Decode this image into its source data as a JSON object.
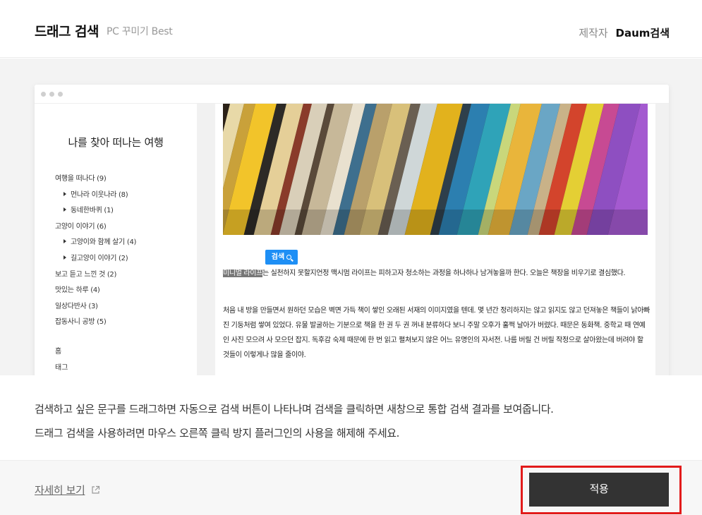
{
  "header": {
    "title": "드래그 검색",
    "subtitle": "PC 꾸미기 Best",
    "maker_label": "제작자",
    "maker_name": "Daum검색"
  },
  "preview": {
    "blog_title": "나를 찾아 떠나는 여행",
    "categories": [
      {
        "label": "여행을 떠나다 (9)",
        "level": 0
      },
      {
        "label": "먼나라 이웃나라 (8)",
        "level": 1
      },
      {
        "label": "동네한바퀴 (1)",
        "level": 1
      },
      {
        "label": "고양이 이야기 (6)",
        "level": 0
      },
      {
        "label": "고양이와 함께 살기 (4)",
        "level": 1
      },
      {
        "label": "길고양이 이야기 (2)",
        "level": 1
      },
      {
        "label": "보고 듣고 느낀 것 (2)",
        "level": 0
      },
      {
        "label": "맛있는 하루 (4)",
        "level": 0
      },
      {
        "label": "일상다반사 (3)",
        "level": 0
      },
      {
        "label": "잡동사니 공방 (5)",
        "level": 0
      }
    ],
    "side_links": [
      "홈",
      "태그"
    ],
    "search_button": "검색",
    "highlight": "미니멀 라이프",
    "paragraph1_rest": "는 실천하지 못할지언정 맥시멈 라이프는 피하고자 청소하는 과정을 하나하나 남겨놓을까 한다. 오늘은 책장을 비우기로 결심했다.",
    "paragraph2": "처음 내 방을 만들면서 원하던 모습은 벽면 가득 책이 쌓인 오래된 서재의 이미지였을 텐데. 몇 년간 정리하지는 않고 읽지도 않고 던져놓은 책들이 낡아빠진 기둥처럼 쌓여 있었다. 유물 발굴하는 기분으로 책을 한 권 두 권 꺼내 분류하다 보니 주말 오후가 훌쩍 날아가 버렸다. 때문은 동화책. 중학교 때 연예인 사진 모으려 사 모으던 잡지. 독후감 숙제 때문에 한 번 읽고 펼쳐보지 않은 어느 유명인의 자서전. 나름 버릴 건 버릴 작정으로 살아왔는데 버려야 할 것들이 이렇게나 많을 줄이야."
  },
  "description": {
    "line1": "검색하고 싶은 문구를 드래그하면 자동으로 검색 버튼이 나타나며 검색을 클릭하면 새창으로 통합 검색 결과를 보여줍니다.",
    "line2": "드래그 검색을 사용하려면 마우스 오른쪽 클릭 방지 플러그인의 사용을 해제해 주세요."
  },
  "footer": {
    "detail_link": "자세히 보기",
    "apply_button": "적용"
  },
  "colors": {
    "accent_blue": "#1e8ff5",
    "apply_bg": "#333333",
    "highlight_border": "#e21b1b"
  }
}
